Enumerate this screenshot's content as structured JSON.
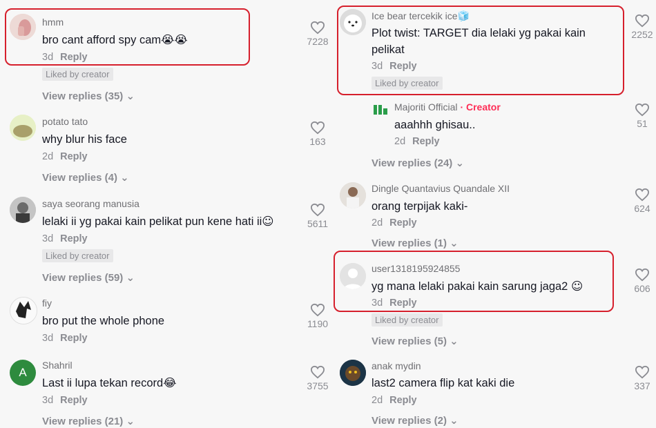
{
  "left_comments": [
    {
      "username": "hmm",
      "text": "bro cant afford spy cam",
      "emoji": "😭😭",
      "time": "3d",
      "reply": "Reply",
      "liked": "Liked by creator",
      "view_replies": "View replies (35)",
      "likes": "7228"
    },
    {
      "username": "potato tato",
      "avatar_label": "a potato",
      "text": "why blur his face",
      "time": "2d",
      "reply": "Reply",
      "view_replies": "View replies (4)",
      "likes": "163"
    },
    {
      "username": "saya seorang manusia",
      "text": "lelaki ii yg pakai kain pelikat pun kene hati ii",
      "emoji": "☺",
      "time": "3d",
      "reply": "Reply",
      "liked": "Liked by creator",
      "view_replies": "View replies (59)",
      "likes": "5611"
    },
    {
      "username": "fiy",
      "text": "bro put the whole phone",
      "time": "3d",
      "reply": "Reply",
      "likes": "1190"
    },
    {
      "username": "Shahril",
      "avatar_letter": "A",
      "text": "Last ii lupa tekan record",
      "emoji": "😂",
      "time": "3d",
      "reply": "Reply",
      "view_replies": "View replies (21)",
      "likes": "3755"
    }
  ],
  "right_comments": [
    {
      "username": "Ice bear tercekik ice",
      "username_emoji": "🧊",
      "text_line1": "Plot twist: TARGET dia lelaki yg pakai kain",
      "text_line2": "pelikat",
      "time": "3d",
      "reply": "Reply",
      "liked": "Liked by creator",
      "likes": "2252"
    },
    {
      "username": "Majoriti Official",
      "creator_tag": "· Creator",
      "text": "aaahhh ghisau..",
      "time": "2d",
      "reply": "Reply",
      "view_replies": "View replies (24)",
      "likes": "51"
    },
    {
      "username": "Dingle Quantavius Quandale XII",
      "text": "orang terpijak kaki-",
      "time": "2d",
      "reply": "Reply",
      "view_replies": "View replies (1)",
      "likes": "624"
    },
    {
      "username": "user1318195924855",
      "text": "yg mana lelaki pakai kain sarung jaga2",
      "emoji": "☺",
      "time": "3d",
      "reply": "Reply",
      "liked": "Liked by creator",
      "view_replies": "View replies (5)",
      "likes": "606"
    },
    {
      "username": "anak mydin",
      "text": "last2 camera flip kat kaki die",
      "time": "2d",
      "reply": "Reply",
      "view_replies": "View replies (2)",
      "likes": "337"
    }
  ],
  "icons": {
    "like": "heart-icon",
    "expand": "chevron-down-icon"
  },
  "colors": {
    "highlight": "#d61f2c",
    "creator": "#fe2c55",
    "avatar_shahril": "#2e8b3e"
  }
}
